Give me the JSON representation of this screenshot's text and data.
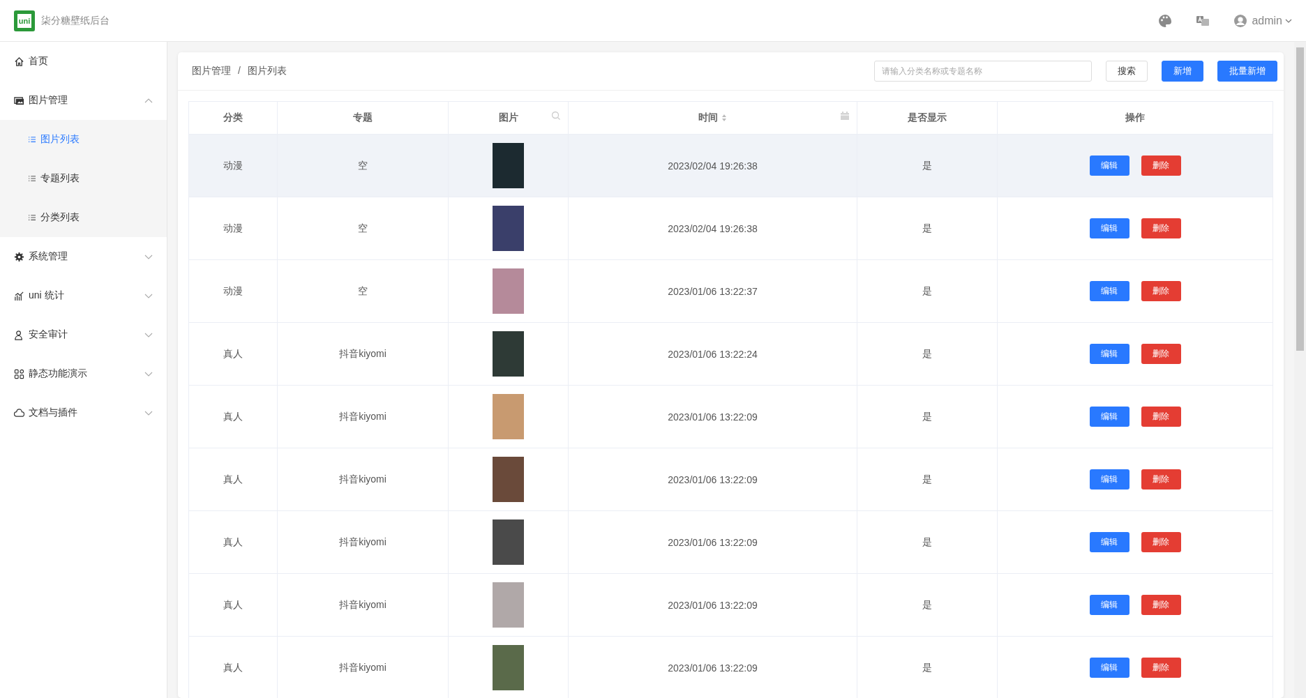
{
  "header": {
    "logo_text": "uni",
    "title": "柒分糖壁纸后台",
    "user": "admin"
  },
  "sidebar": {
    "items": [
      {
        "label": "首页"
      },
      {
        "label": "图片管理",
        "expanded": true,
        "children": [
          {
            "label": "图片列表",
            "selected": true
          },
          {
            "label": "专题列表",
            "selected": false
          },
          {
            "label": "分类列表",
            "selected": false
          }
        ]
      },
      {
        "label": "系统管理",
        "expanded": false
      },
      {
        "label": "uni 统计",
        "expanded": false
      },
      {
        "label": "安全审计",
        "expanded": false
      },
      {
        "label": "静态功能演示",
        "expanded": false
      },
      {
        "label": "文档与插件",
        "expanded": false
      }
    ]
  },
  "breadcrumb": [
    "图片管理",
    "/",
    "图片列表"
  ],
  "search": {
    "placeholder": "请输入分类名称或专题名称"
  },
  "buttons": [
    {
      "label": "搜索",
      "kind": "plain"
    },
    {
      "label": "新增",
      "kind": "primary"
    },
    {
      "label": "批量新增",
      "kind": "primary"
    }
  ],
  "table": {
    "columns": [
      "分类",
      "专题",
      "图片",
      "时间",
      "是否显示",
      "操作"
    ],
    "rows": [
      {
        "category": "动漫",
        "topic": "空",
        "time": "2023/02/04 19:26:38",
        "visible": "是",
        "highlighted": true,
        "actions": [
          "编辑",
          "删除"
        ]
      },
      {
        "category": "动漫",
        "topic": "空",
        "time": "2023/02/04 19:26:38",
        "visible": "是",
        "highlighted": false,
        "actions": [
          "编辑",
          "删除"
        ]
      },
      {
        "category": "动漫",
        "topic": "空",
        "time": "2023/01/06 13:22:37",
        "visible": "是",
        "highlighted": false,
        "actions": [
          "编辑",
          "删除"
        ]
      },
      {
        "category": "真人",
        "topic": "抖音kiyomi",
        "time": "2023/01/06 13:22:24",
        "visible": "是",
        "highlighted": false,
        "actions": [
          "编辑",
          "删除"
        ]
      },
      {
        "category": "真人",
        "topic": "抖音kiyomi",
        "time": "2023/01/06 13:22:09",
        "visible": "是",
        "highlighted": false,
        "actions": [
          "编辑",
          "删除"
        ]
      },
      {
        "category": "真人",
        "topic": "抖音kiyomi",
        "time": "2023/01/06 13:22:09",
        "visible": "是",
        "highlighted": false,
        "actions": [
          "编辑",
          "删除"
        ]
      },
      {
        "category": "真人",
        "topic": "抖音kiyomi",
        "time": "2023/01/06 13:22:09",
        "visible": "是",
        "highlighted": false,
        "actions": [
          "编辑",
          "删除"
        ]
      },
      {
        "category": "真人",
        "topic": "抖音kiyomi",
        "time": "2023/01/06 13:22:09",
        "visible": "是",
        "highlighted": false,
        "actions": [
          "编辑",
          "删除"
        ]
      },
      {
        "category": "真人",
        "topic": "抖音kiyomi",
        "time": "2023/01/06 13:22:09",
        "visible": "是",
        "highlighted": false,
        "actions": [
          "编辑",
          "删除"
        ]
      }
    ]
  }
}
